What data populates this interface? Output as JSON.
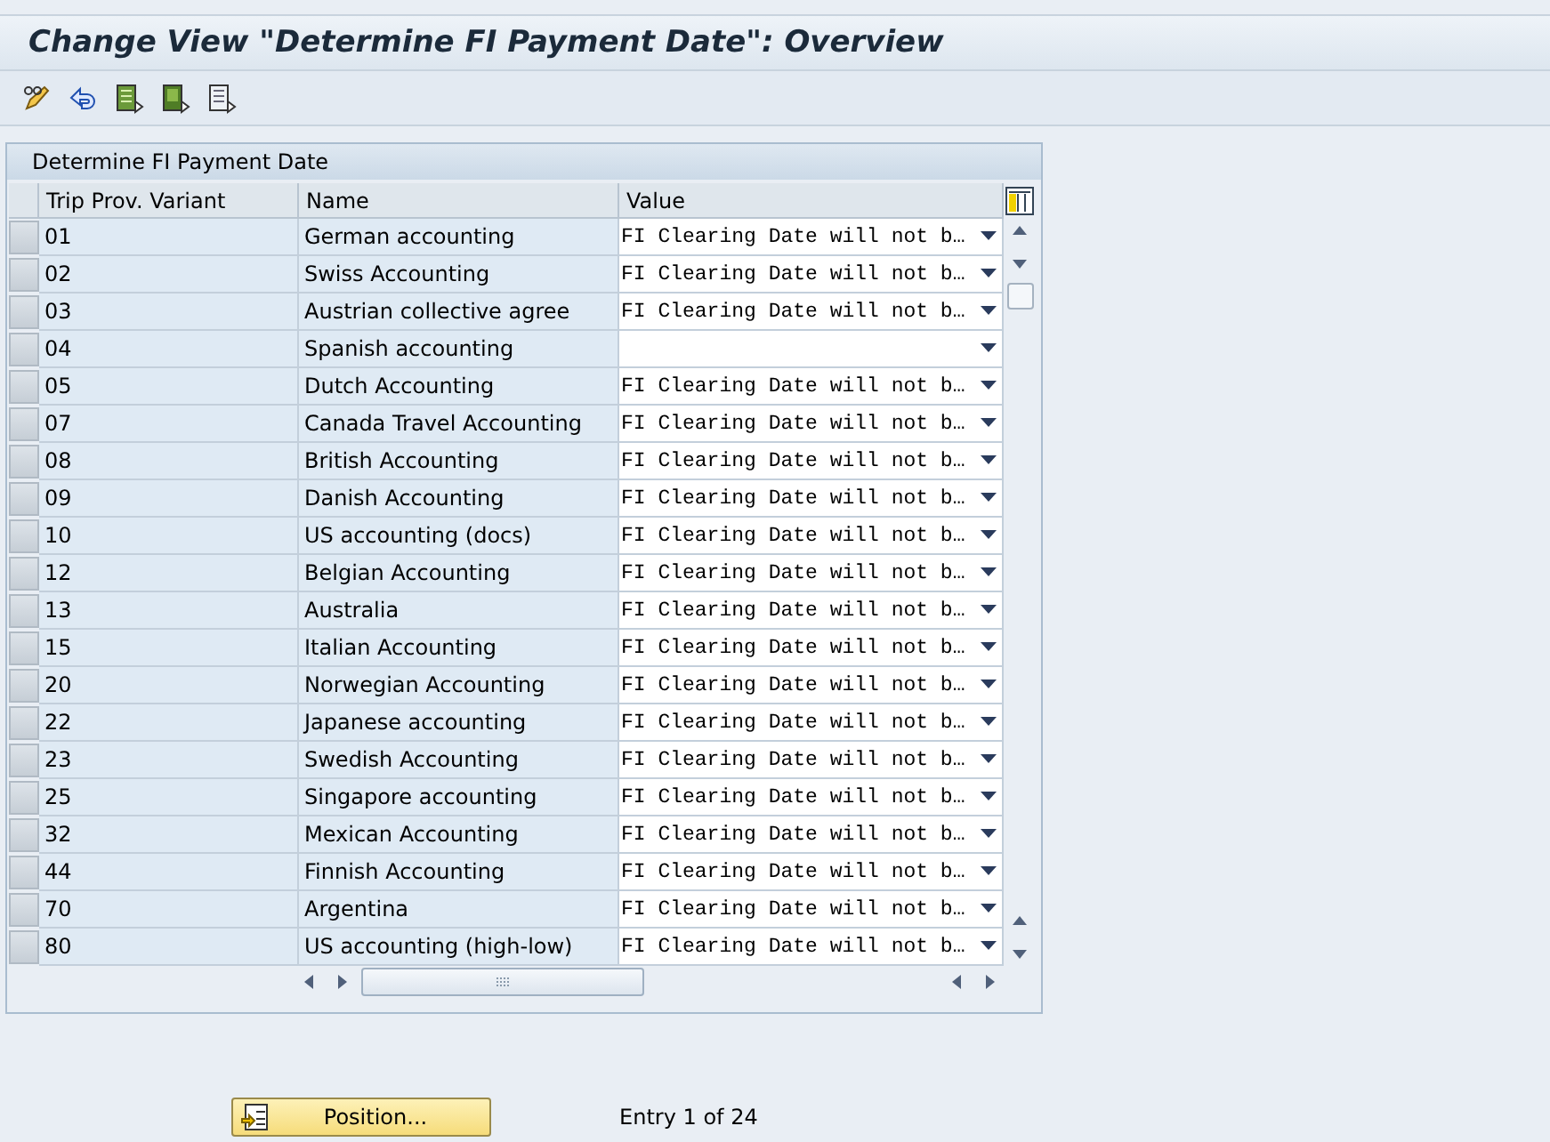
{
  "window": {
    "title": "Change View \"Determine FI Payment Date\": Overview"
  },
  "table": {
    "title": "Determine FI Payment Date",
    "columns": [
      "Trip Prov. Variant",
      "Name",
      "Value"
    ],
    "rows": [
      {
        "variant": "01",
        "name": "German accounting",
        "value": "FI Clearing Date will not b…"
      },
      {
        "variant": "02",
        "name": "Swiss Accounting",
        "value": "FI Clearing Date will not b…"
      },
      {
        "variant": "03",
        "name": "Austrian collective agree",
        "value": "FI Clearing Date will not b…"
      },
      {
        "variant": "04",
        "name": "Spanish accounting"
      },
      {
        "variant": "05",
        "name": "Dutch Accounting",
        "value": "FI Clearing Date will not b…"
      },
      {
        "variant": "07",
        "name": "Canada Travel Accounting",
        "value": "FI Clearing Date will not b…"
      },
      {
        "variant": "08",
        "name": "British Accounting",
        "value": "FI Clearing Date will not b…"
      },
      {
        "variant": "09",
        "name": "Danish Accounting",
        "value": "FI Clearing Date will not b…"
      },
      {
        "variant": "10",
        "name": "US accounting (docs)",
        "value": "FI Clearing Date will not b…"
      },
      {
        "variant": "12",
        "name": "Belgian Accounting",
        "value": "FI Clearing Date will not b…"
      },
      {
        "variant": "13",
        "name": "Australia",
        "value": "FI Clearing Date will not b…"
      },
      {
        "variant": "15",
        "name": "Italian Accounting",
        "value": "FI Clearing Date will not b…"
      },
      {
        "variant": "20",
        "name": "Norwegian Accounting",
        "value": "FI Clearing Date will not b…"
      },
      {
        "variant": "22",
        "name": "Japanese accounting",
        "value": "FI Clearing Date will not b…"
      },
      {
        "variant": "23",
        "name": "Swedish Accounting",
        "value": "FI Clearing Date will not b…"
      },
      {
        "variant": "25",
        "name": "Singapore accounting",
        "value": "FI Clearing Date will not b…"
      },
      {
        "variant": "32",
        "name": "Mexican Accounting",
        "value": "FI Clearing Date will not b…"
      },
      {
        "variant": "44",
        "name": "Finnish Accounting",
        "value": "FI Clearing Date will not b…"
      },
      {
        "variant": "70",
        "name": "Argentina",
        "value": "FI Clearing Date will not b…"
      },
      {
        "variant": "80",
        "name": "US accounting (high-low)",
        "value": "FI Clearing Date will not b…"
      }
    ]
  },
  "footer": {
    "button": "Position...",
    "entry": "Entry 1 of 24"
  }
}
